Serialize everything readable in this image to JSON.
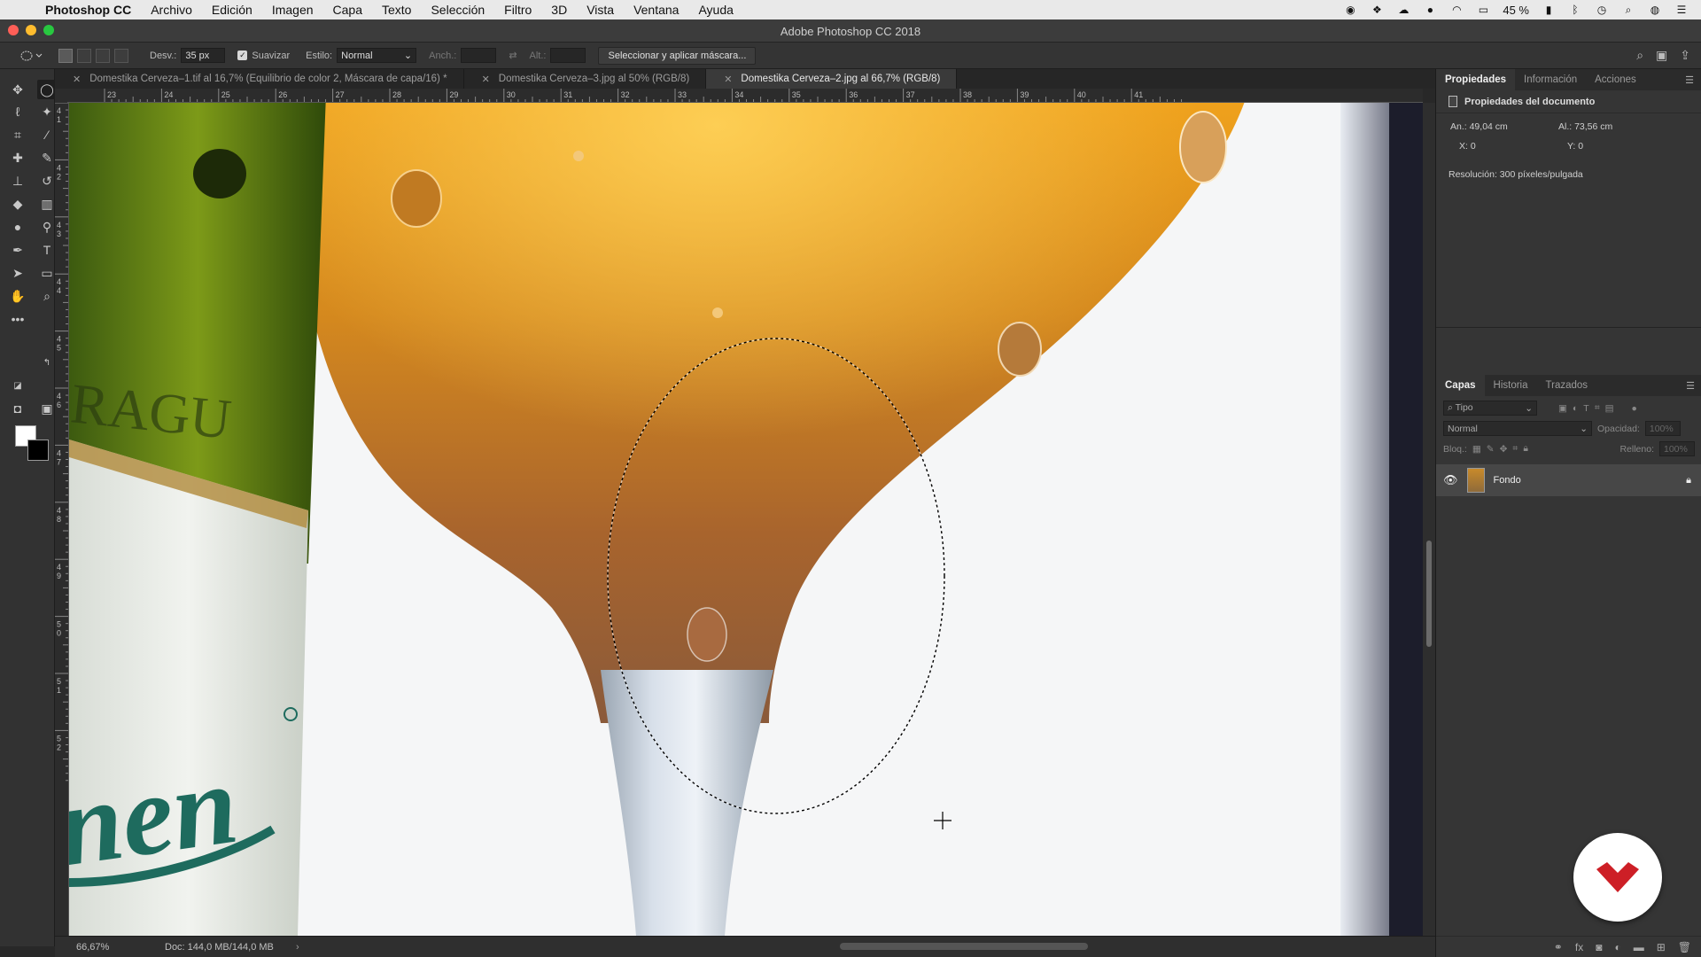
{
  "menubar": {
    "app_name": "Photoshop CC",
    "items": [
      "Archivo",
      "Edición",
      "Imagen",
      "Capa",
      "Texto",
      "Selección",
      "Filtro",
      "3D",
      "Vista",
      "Ventana",
      "Ayuda"
    ],
    "battery": "45 %"
  },
  "window": {
    "title": "Adobe Photoshop CC 2018"
  },
  "options": {
    "feather_label": "Desv.:",
    "feather_value": "35 px",
    "antialias_label": "Suavizar",
    "style_label": "Estilo:",
    "style_value": "Normal",
    "width_label": "Anch.:",
    "height_label": "Alt.:",
    "mask_button": "Seleccionar y aplicar máscara..."
  },
  "tabs": [
    {
      "label": "Domestika Cerveza–1.tif al 16,7% (Equilibrio de color 2, Máscara de capa/16) *"
    },
    {
      "label": "Domestika Cerveza–3.jpg al 50% (RGB/8)"
    },
    {
      "label": "Domestika Cerveza–2.jpg al 66,7% (RGB/8)"
    }
  ],
  "ruler": {
    "top": [
      "23",
      "24",
      "25",
      "26",
      "27",
      "28",
      "29",
      "30",
      "31",
      "32",
      "33",
      "34",
      "35",
      "36",
      "37",
      "38",
      "39",
      "40",
      "41"
    ],
    "left": [
      "41",
      "42",
      "43",
      "44",
      "45",
      "46",
      "47",
      "48",
      "49",
      "50",
      "51",
      "52"
    ]
  },
  "status": {
    "zoom": "66,67%",
    "doc": "Doc: 144,0 MB/144,0 MB"
  },
  "properties_panel": {
    "tabs": [
      "Propiedades",
      "Información",
      "Acciones"
    ],
    "header": "Propiedades del documento",
    "width": "An.: 49,04 cm",
    "height": "Al.: 73,56 cm",
    "x": "X:  0",
    "y": "Y:  0",
    "resolution": "Resolución: 300 píxeles/pulgada"
  },
  "layers_panel": {
    "tabs": [
      "Capas",
      "Historia",
      "Trazados"
    ],
    "filter_placeholder": "Tipo",
    "blend_mode": "Normal",
    "opacity_label": "Opacidad:",
    "opacity_value": "100%",
    "lock_label": "Bloq.:",
    "fill_label": "Relleno:",
    "fill_value": "100%",
    "layers": [
      {
        "name": "Fondo",
        "visible": true,
        "locked": true
      }
    ]
  },
  "colors": {
    "accent": "#cd1f26",
    "foreground": "#ffffff",
    "background": "#000000"
  }
}
